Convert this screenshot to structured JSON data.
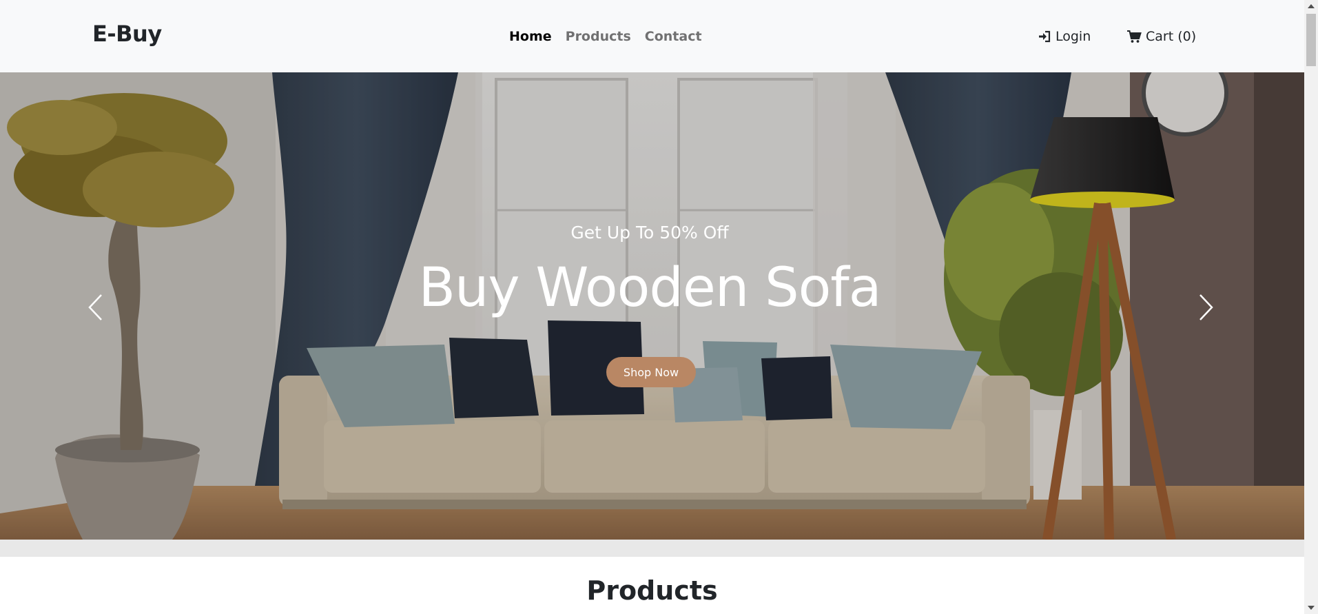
{
  "navbar": {
    "brand": "E-Buy",
    "links": [
      {
        "label": "Home",
        "active": true
      },
      {
        "label": "Products",
        "active": false
      },
      {
        "label": "Contact",
        "active": false
      }
    ],
    "login_label": "Login",
    "login_icon": "sign-in-icon",
    "cart_label": "Cart (0)",
    "cart_icon": "shopping-cart-icon"
  },
  "hero": {
    "subtitle": "Get Up To 50% Off",
    "title": "Buy Wooden Sofa",
    "button_label": "Shop Now",
    "accent_color": "#b98764",
    "prev_icon": "chevron-left-icon",
    "next_icon": "chevron-right-icon"
  },
  "products": {
    "heading": "Products"
  }
}
